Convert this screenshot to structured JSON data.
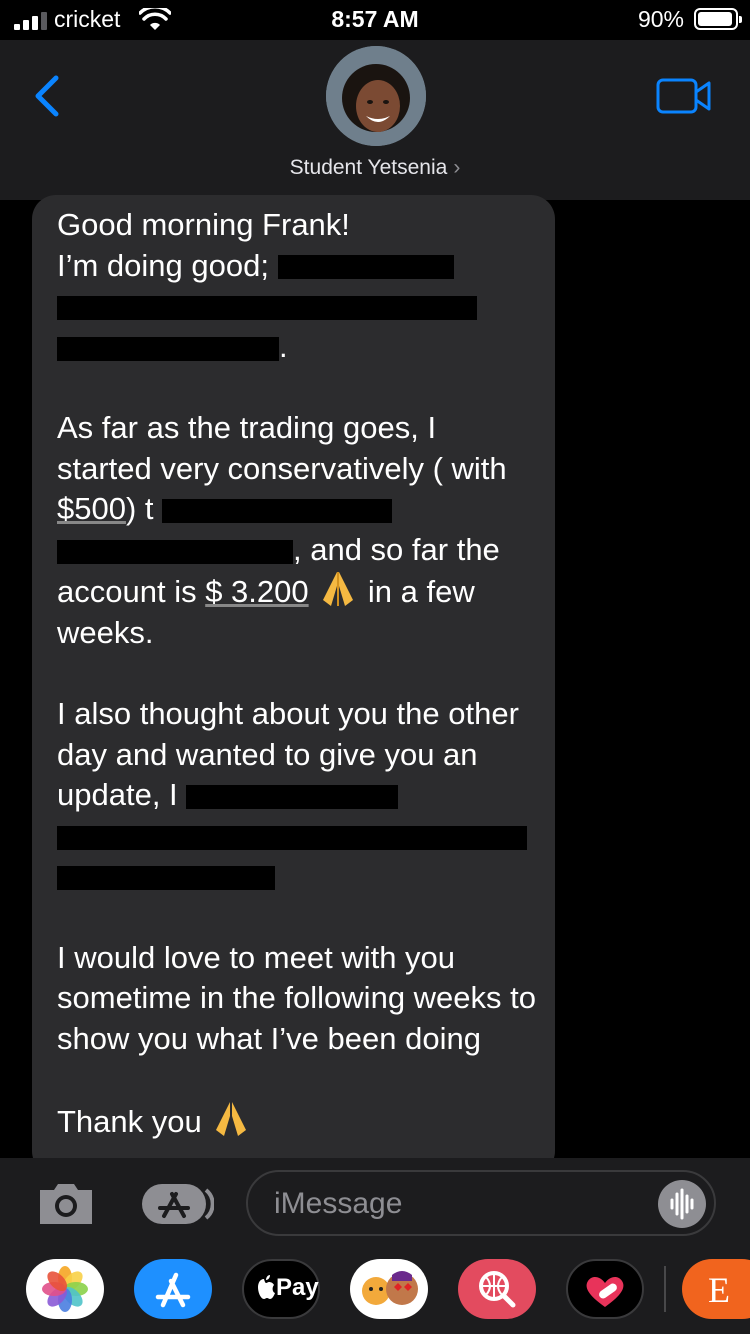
{
  "status_bar": {
    "carrier": "cricket",
    "time": "8:57 AM",
    "battery_percent": "90%",
    "battery_level": 0.9
  },
  "header": {
    "contact_name": "Student Yetsenia",
    "chevron": "›"
  },
  "message": {
    "p1": {
      "l1": "Good morning Frank!",
      "l2": "I’m doing good;",
      "l3_tail": ".",
      "redaction_note": ""
    },
    "p2": {
      "text_a": "As far as the trading goes, I started very conservatively ( with ",
      "amount_start": "$500",
      "text_b": ") t",
      "text_c": ", and so far the account is ",
      "amount_now": "$ 3.200",
      "text_d": " in a few weeks."
    },
    "p3": {
      "text_a": "I also thought about you the other day and wanted to give you an update, I"
    },
    "p4": {
      "text": "I would love to meet with you sometime in the following weeks to show you what I’ve been doing"
    },
    "p5": {
      "text": "Thank you"
    }
  },
  "input": {
    "placeholder": "iMessage"
  },
  "app_drawer": {
    "apps": [
      "photos-icon",
      "app-store-icon",
      "apple-pay-icon",
      "memoji-icon",
      "search-globe-icon",
      "heart-app-icon",
      "etsy-icon"
    ],
    "apple_pay_label": "Pay",
    "etsy_label": "E"
  },
  "colors": {
    "accent": "#0a84ff",
    "bubble": "#2c2c2e",
    "header": "#1c1c1e"
  }
}
